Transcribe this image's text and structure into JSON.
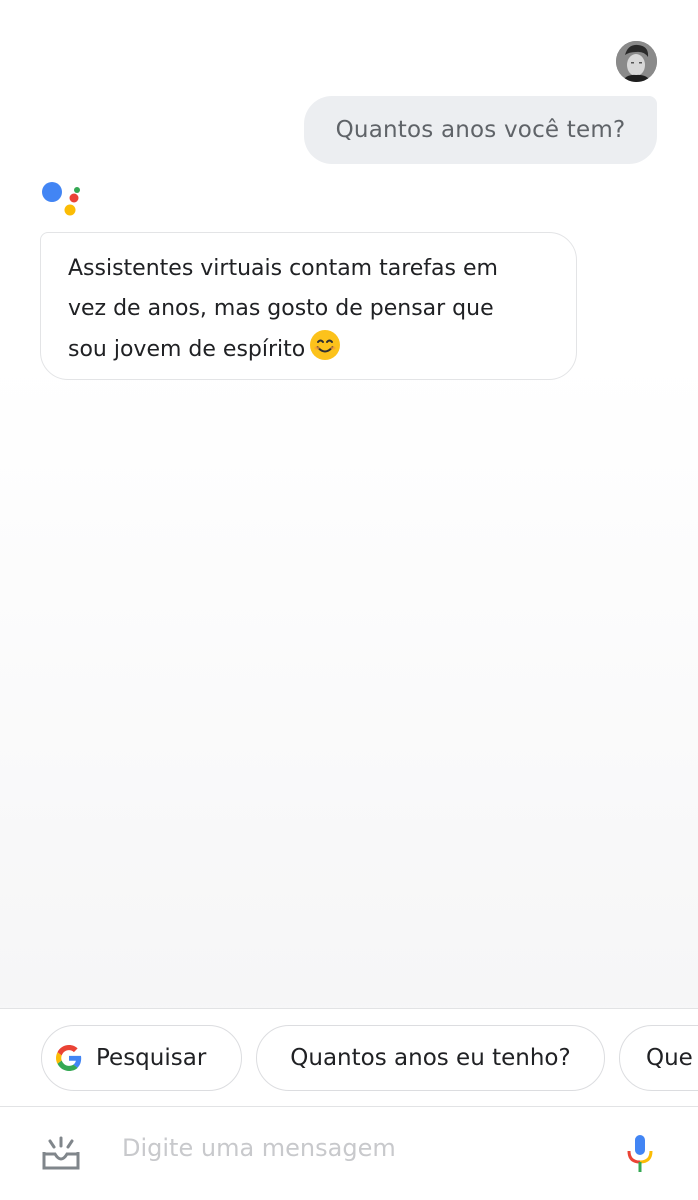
{
  "conversation": {
    "user_message": "Quantos anos você tem?",
    "assistant_reply": {
      "line1": "Assistentes virtuais contam tarefas em",
      "line2": "vez de anos, mas gosto de pensar que",
      "line3": "sou jovem de espírito"
    },
    "reply_emoji": "smiling-face-icon"
  },
  "suggestions": [
    {
      "label": "Pesquisar",
      "icon": "google-g-icon"
    },
    {
      "label": "Quantos anos eu tenho?"
    },
    {
      "label": "Que"
    }
  ],
  "input": {
    "placeholder": "Digite uma mensagem",
    "left_icon": "tray-icon",
    "right_icon": "mic-icon"
  },
  "colors": {
    "google_blue": "#4285f4",
    "google_red": "#ea4335",
    "google_yellow": "#fbbc05",
    "google_green": "#34a853"
  }
}
